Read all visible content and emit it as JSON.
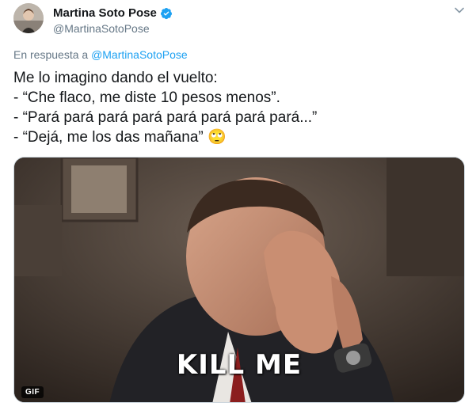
{
  "author": {
    "display_name": "Martina Soto Pose",
    "handle": "@MartinaSotoPose",
    "verified": true,
    "verified_icon": "verified-badge-icon",
    "menu_icon": "chevron-down-icon"
  },
  "reply": {
    "prefix": "En respuesta a",
    "mention": "@MartinaSotoPose"
  },
  "tweet": {
    "lines": [
      "Me lo imagino dando el vuelto:",
      "- “Che flaco, me diste 10 pesos menos”.",
      "- “Pará pará pará pará pará pará pará pará...”",
      "- “Dejá, me los das mañana” 🙄"
    ]
  },
  "media": {
    "type": "gif",
    "caption": "KILL ME",
    "badge": "GIF"
  },
  "colors": {
    "link": "#1da1f2",
    "secondary_text": "#657786",
    "primary_text": "#14171a",
    "verified": "#1da1f2"
  }
}
